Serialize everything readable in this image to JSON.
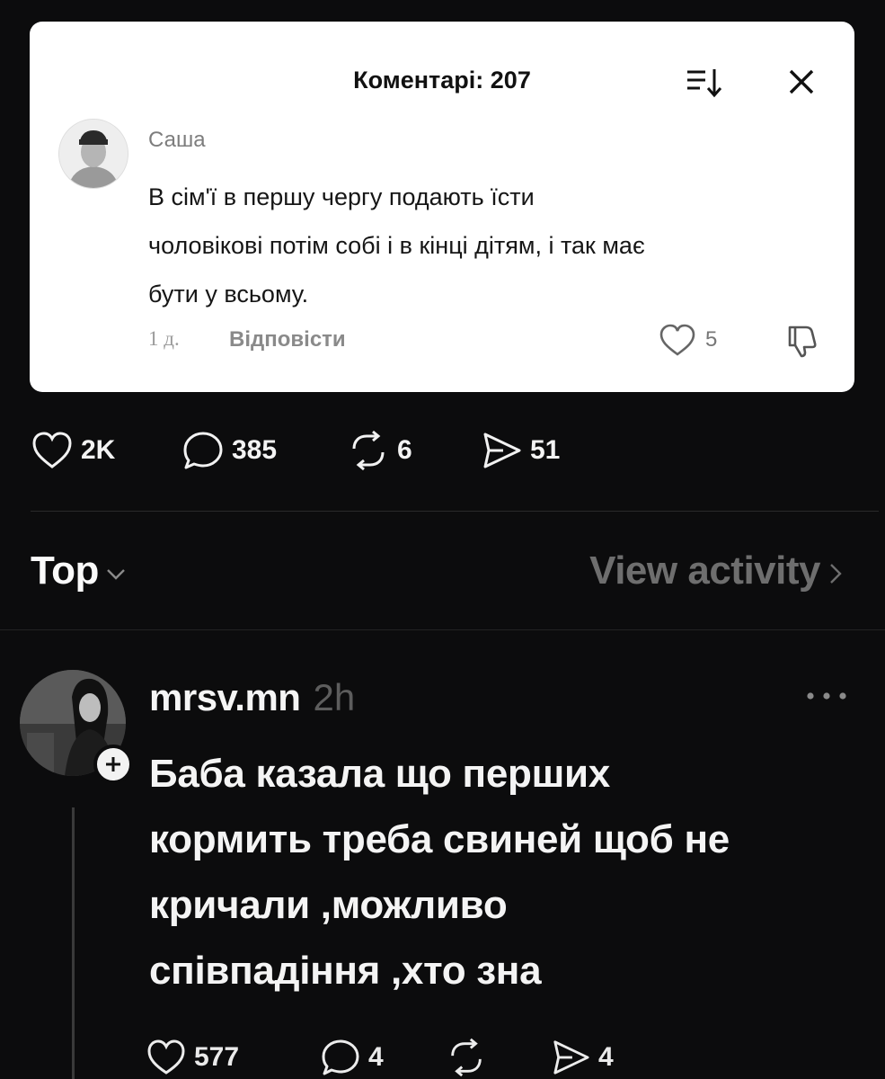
{
  "comment_card": {
    "title": "Коментарі: 207",
    "author": "Саша",
    "text_lines": [
      "В сім'ї в першу чергу подають їсти",
      "чоловікові потім собі і в кінці дітям, і так має",
      "бути у всьому."
    ],
    "time": "1 д.",
    "reply_label": "Відповісти",
    "like_count": "5",
    "icons": [
      "sort-icon",
      "close-icon",
      "heart-icon",
      "dislike-icon"
    ]
  },
  "post_actions": {
    "likes": "2K",
    "comments": "385",
    "reposts": "6",
    "shares": "51"
  },
  "sort_bar": {
    "sort_label": "Top",
    "activity_label": "View activity"
  },
  "reply": {
    "username": "mrsv.mn",
    "time": "2h",
    "text_lines": [
      "Баба казала що перших",
      "кормить треба свиней щоб не",
      "кричали ,можливо",
      "співпадіння ,хто зна"
    ],
    "likes": "577",
    "comments": "4",
    "shares": "4"
  }
}
